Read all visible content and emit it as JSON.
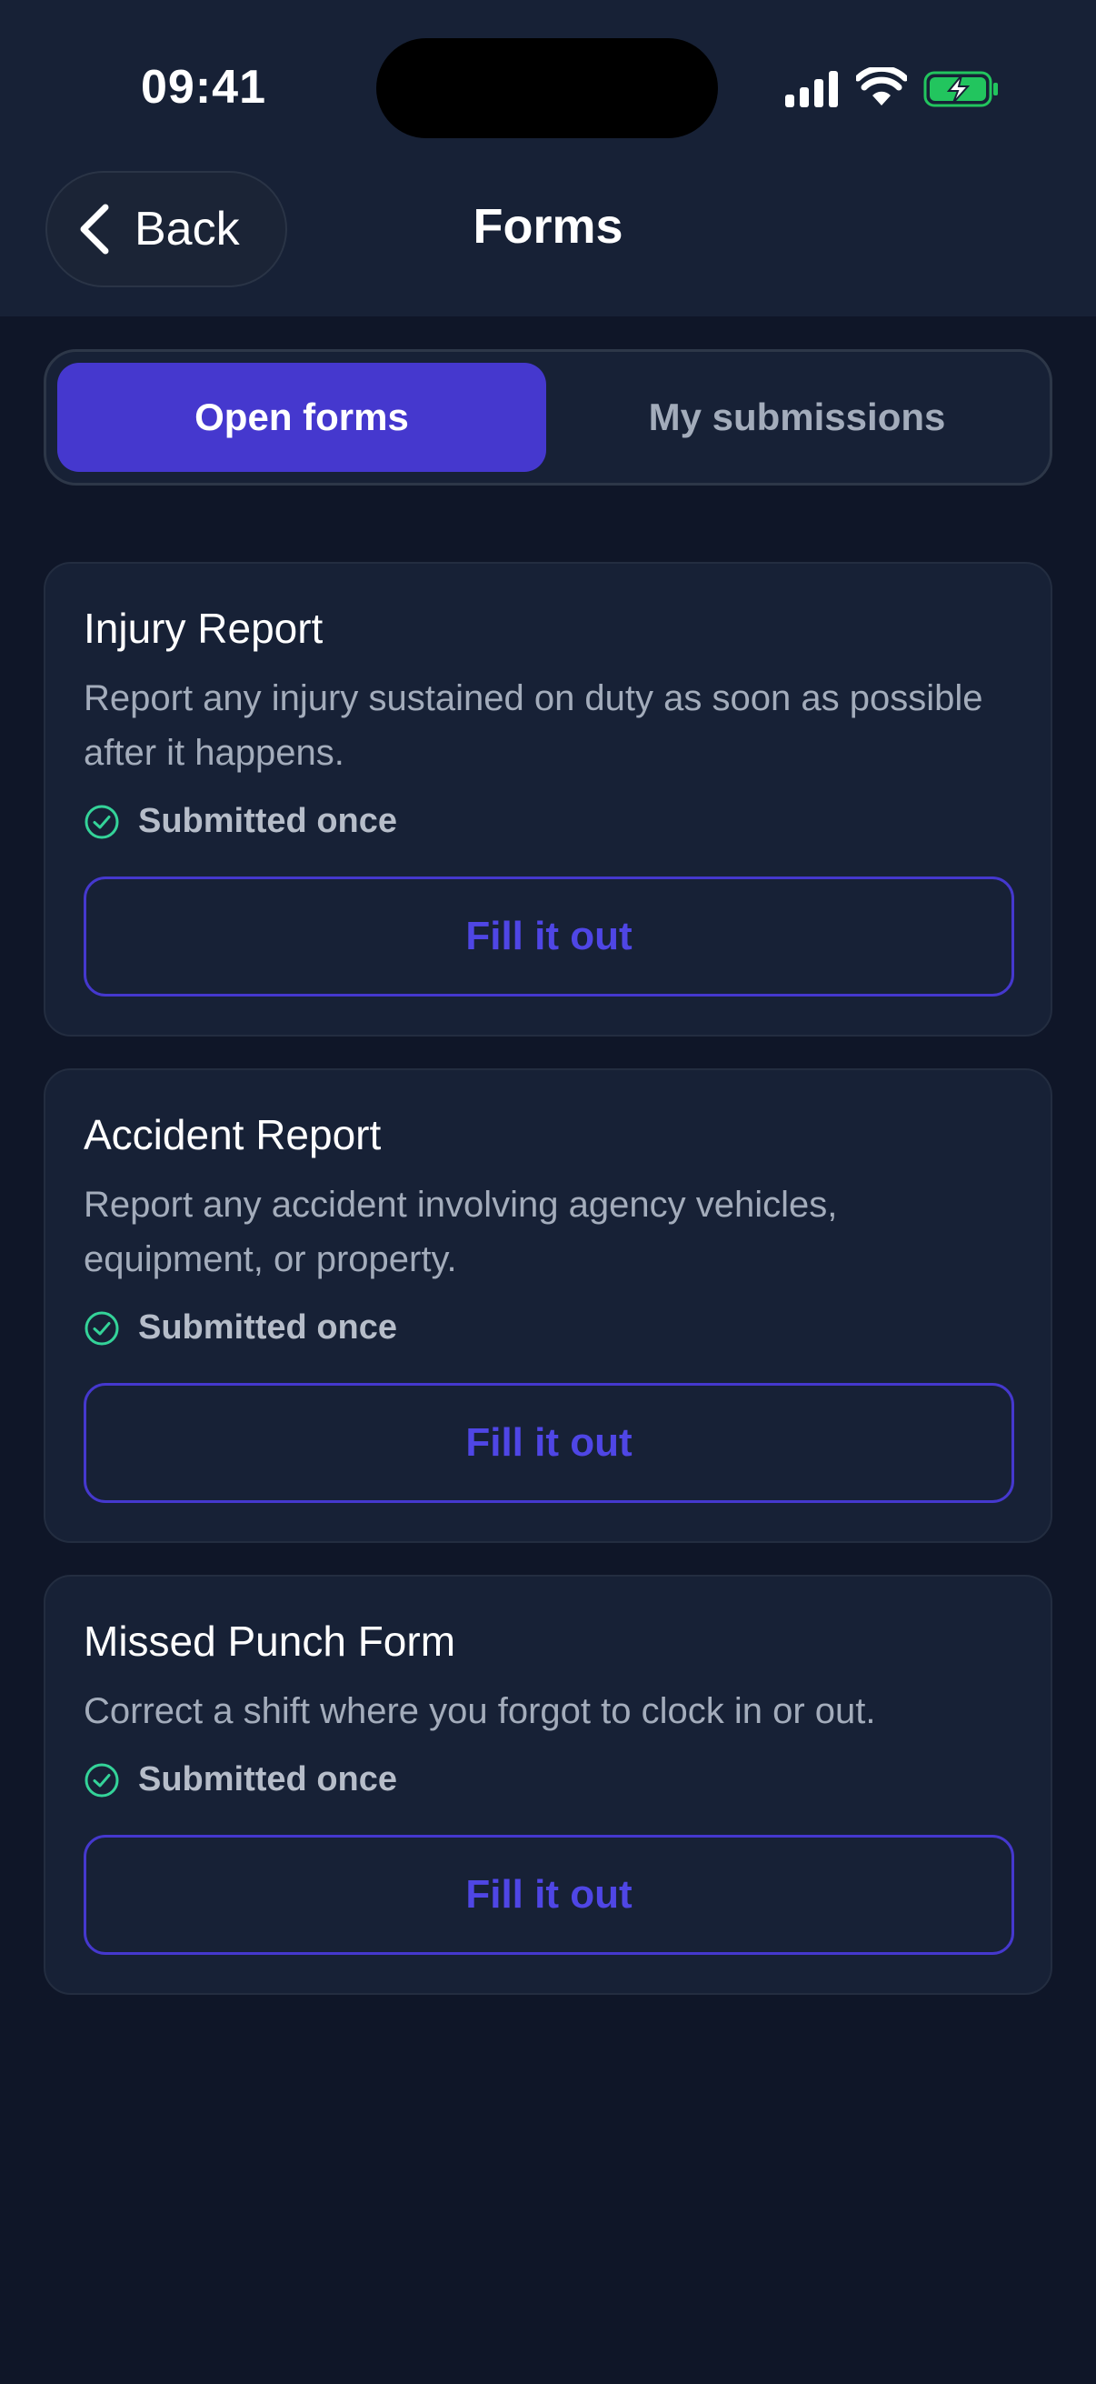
{
  "status_bar": {
    "time": "09:41",
    "icons": [
      "signal-icon",
      "wifi-icon",
      "battery-charging-icon"
    ],
    "battery_color": "#22c55e"
  },
  "header": {
    "back_label": "Back",
    "title": "Forms",
    "background": "#172136"
  },
  "tabs": [
    {
      "label": "Open forms",
      "active": true
    },
    {
      "label": "My submissions",
      "active": false
    }
  ],
  "colors": {
    "accent": "#4538ce",
    "success": "#34d399",
    "page_bg": "#0f1628",
    "card_bg": "#172136"
  },
  "forms": [
    {
      "title": "Injury Report",
      "description": "Report any injury sustained on duty as soon as possible after it happens.",
      "status": "Submitted once",
      "button_label": "Fill it out"
    },
    {
      "title": "Accident Report",
      "description": "Report any accident involving agency vehicles, equipment, or property.",
      "status": "Submitted once",
      "button_label": "Fill it out"
    },
    {
      "title": "Missed Punch Form",
      "description": "Correct a shift where you forgot to clock in or out.",
      "status": "Submitted once",
      "button_label": "Fill it out"
    }
  ]
}
